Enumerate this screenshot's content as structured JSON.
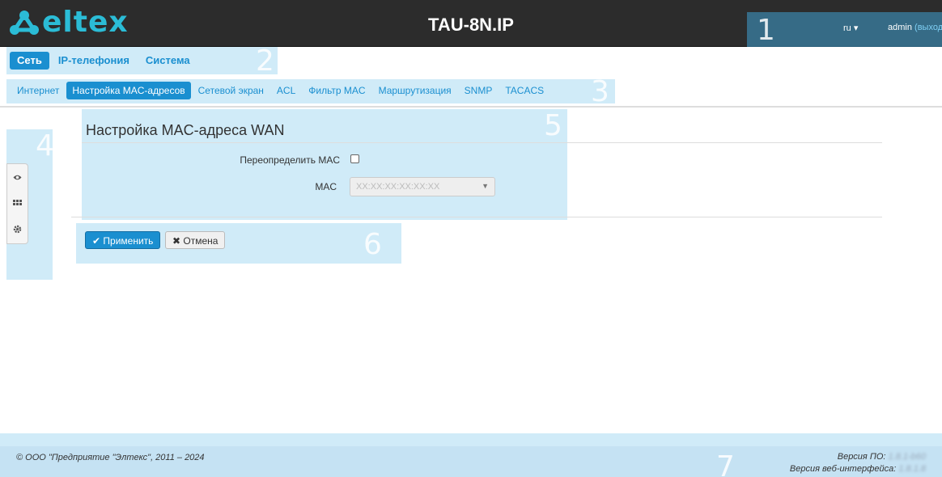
{
  "header": {
    "logo_text": "eltex",
    "device_title": "TAU-8N.IP",
    "lang": "ru ▾",
    "user": "admin",
    "logout": "(выход)",
    "overlay_number": "1"
  },
  "top_tabs": {
    "overlay_number": "2",
    "items": [
      {
        "label": "Сеть",
        "active": true
      },
      {
        "label": "IP-телефония",
        "active": false
      },
      {
        "label": "Система",
        "active": false
      }
    ]
  },
  "sub_tabs": {
    "overlay_number": "3",
    "items": [
      {
        "label": "Интернет",
        "active": false
      },
      {
        "label": "Настройка MAC-адресов",
        "active": true
      },
      {
        "label": "Сетевой экран",
        "active": false
      },
      {
        "label": "ACL",
        "active": false
      },
      {
        "label": "Фильтр MAC",
        "active": false
      },
      {
        "label": "Маршрутизация",
        "active": false
      },
      {
        "label": "SNMP",
        "active": false
      },
      {
        "label": "TACACS",
        "active": false
      }
    ]
  },
  "side_panel": {
    "overlay_number": "4",
    "icons": [
      "eye-icon",
      "grid-icon",
      "gear-icon"
    ]
  },
  "form": {
    "overlay_number": "5",
    "title": "Настройка MAC-адреса WAN",
    "override_label": "Переопределить MAC",
    "override_checked": false,
    "mac_label": "MAC",
    "mac_placeholder": "XX:XX:XX:XX:XX:XX"
  },
  "actions": {
    "overlay_number": "6",
    "apply_label": "Применить",
    "cancel_label": "Отмена"
  },
  "footer": {
    "overlay_number": "7",
    "copyright": "© ООО \"Предприятие \"Элтекс\", 2011 – 2024",
    "fw_label": "Версия ПО:",
    "fw_value": "1.8.1-b60",
    "web_label": "Версия веб-интерфейса:",
    "web_value": "1.8.1.8"
  },
  "colors": {
    "accent": "#1a8fd0",
    "header_bg": "#2c2c2c",
    "logo": "#2bbcd6",
    "overlay": "#96d2f0"
  }
}
